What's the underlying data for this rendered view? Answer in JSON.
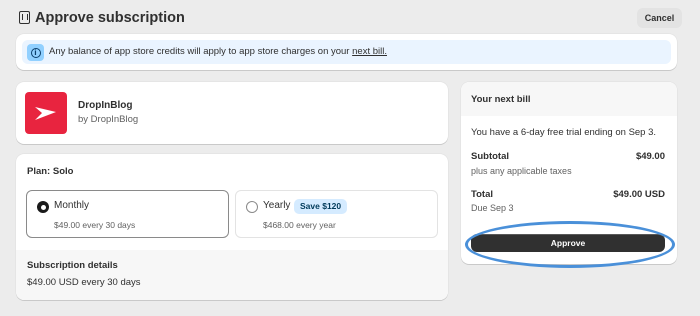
{
  "header": {
    "title": "Approve subscription",
    "cancel_label": "Cancel"
  },
  "banner": {
    "text": "Any balance of app store credits will apply to app store charges on your ",
    "link": "next bill."
  },
  "app": {
    "name": "DropInBlog",
    "by": "by DropInBlog",
    "logo_color": "#e8243f"
  },
  "plan": {
    "label": "Plan: Solo",
    "options": [
      {
        "title": "Monthly",
        "price": "$49.00 every 30 days",
        "selected": true
      },
      {
        "title": "Yearly",
        "badge": "Save $120",
        "price": "$468.00 every year",
        "selected": false
      }
    ],
    "details_title": "Subscription details",
    "details_value": "$49.00 USD every 30 days"
  },
  "bill": {
    "title": "Your next bill",
    "trial": "You have a 6-day free trial ending on Sep 3.",
    "subtotal_label": "Subtotal",
    "subtotal_value": "$49.00",
    "subtotal_sub": "plus any applicable taxes",
    "total_label": "Total",
    "total_value": "$49.00 USD",
    "total_sub": "Due Sep 3",
    "approve_label": "Approve"
  },
  "colors": {
    "accent": "#303030",
    "badge_bg": "#d5ebff",
    "banner_bg": "#eaf4ff",
    "highlight": "#4a90d9"
  }
}
